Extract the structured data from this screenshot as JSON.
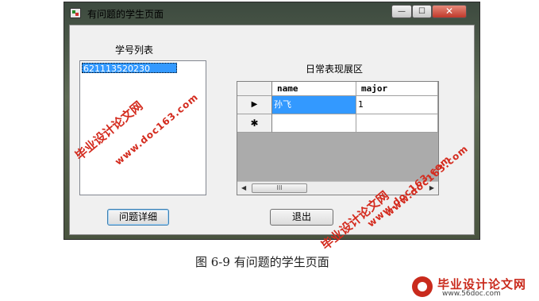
{
  "window": {
    "title": "有问题的学生页面",
    "controls": {
      "minimize": "—",
      "maximize": "☐",
      "close": "✕"
    }
  },
  "left_panel": {
    "label": "学号列表",
    "list_items": [
      "621113520230"
    ],
    "selected_index": 0
  },
  "right_panel": {
    "label": "日常表现展区",
    "grid": {
      "columns": [
        "name",
        "major"
      ],
      "rows": [
        {
          "indicator": "▶",
          "name": "孙飞",
          "major": "1"
        },
        {
          "indicator": "✱",
          "name": "",
          "major": ""
        }
      ],
      "scroll_thumb": "III"
    }
  },
  "buttons": {
    "details": "问题详细",
    "exit": "退出"
  },
  "caption": "图 6-9 有问题的学生页面",
  "watermarks": {
    "text_cn": "毕业设计论文网",
    "url": "www.doc163.com"
  },
  "logo": {
    "text": "毕业设计论文网",
    "url": "www.56doc.com"
  },
  "colors": {
    "selection": "#3399ff",
    "watermark": "#d42b1e"
  }
}
